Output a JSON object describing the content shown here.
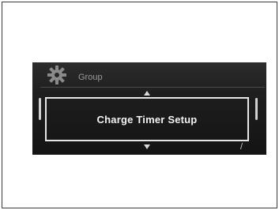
{
  "menu": {
    "group_label": "Group",
    "selected_item": "Charge Timer Setup",
    "group_icon": "gear-icon",
    "scroll_up_icon": "arrow-up-icon",
    "scroll_down_icon": "arrow-down-icon",
    "corner_mark": "/"
  },
  "colors": {
    "screen_bg": "#1e1e1e",
    "highlight_border": "#e6e6e6",
    "text": "#f2f2f2",
    "group_text": "#9a9a9a"
  }
}
